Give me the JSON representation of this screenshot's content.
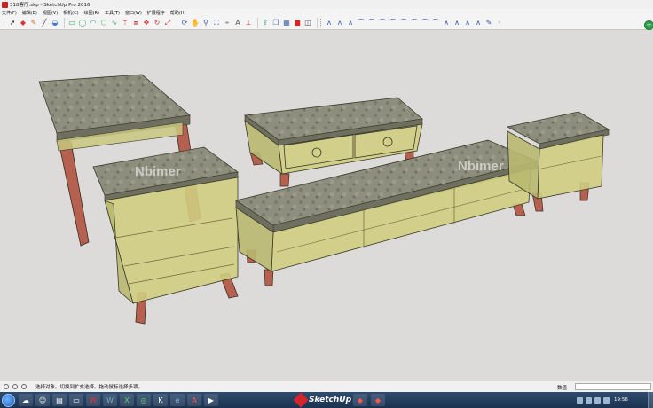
{
  "window": {
    "title": "318客厅.skp - SketchUp Pro 2016"
  },
  "menu": {
    "items": [
      {
        "label": "文件(F)"
      },
      {
        "label": "编辑(E)"
      },
      {
        "label": "视图(V)"
      },
      {
        "label": "相机(C)"
      },
      {
        "label": "绘图(R)"
      },
      {
        "label": "工具(T)"
      },
      {
        "label": "窗口(W)"
      },
      {
        "label": "扩展程序"
      },
      {
        "label": "帮助(H)"
      }
    ]
  },
  "toolbar": {
    "groups": [
      {
        "icons": [
          "select-arrow-icon",
          "eraser-icon",
          "pencil-icon",
          "line-icon",
          "paint-bucket-icon"
        ]
      },
      {
        "icons": [
          "rectangle-icon",
          "circle-icon",
          "arc-icon",
          "polygon-icon",
          "freehand-icon",
          "push-pull-icon",
          "offset-icon",
          "move-icon",
          "rotate-icon",
          "scale-icon"
        ]
      },
      {
        "icons": [
          "orbit-icon",
          "pan-icon",
          "zoom-icon",
          "zoom-extents-icon",
          "tape-measure-icon",
          "text-icon",
          "axes-icon"
        ]
      },
      {
        "icons": [
          "export-icon",
          "component-icon",
          "material-icon",
          "stop-icon",
          "camera-icon"
        ]
      },
      {
        "icons": [
          "curve-1-icon",
          "curve-2-icon",
          "curve-3-icon",
          "curve-4-icon",
          "curve-5-icon",
          "curve-6-icon",
          "curve-7-icon",
          "curve-8-icon",
          "curve-9-icon",
          "curve-10-icon",
          "curve-11-icon",
          "curve-12-icon",
          "curve-13-icon",
          "curve-14-icon",
          "curve-15-icon",
          "curve-16-icon",
          "curve-17-icon"
        ]
      }
    ]
  },
  "viewport": {
    "watermarks": [
      "Nbimer",
      "Nbimer"
    ],
    "colors": {
      "background": "#dcdbd9",
      "marble": "#8a8a7a",
      "glass_body": "#c6c67a",
      "wood_leg": "#b35a48",
      "edge": "#3a3a2a"
    }
  },
  "status": {
    "text": "选择对象。切换到扩充选择。拖动鼠标选择多项。",
    "measure_label": "数值",
    "measure_value": ""
  },
  "taskbar": {
    "apps": [
      "network",
      "qq",
      "explorer",
      "folder",
      "wps",
      "word",
      "excel",
      "browser",
      "k-app",
      "ie",
      "autocad",
      "media",
      "sketchup-1",
      "sketchup-2"
    ],
    "center_brand": "SketchUp",
    "clock": "19:56"
  }
}
